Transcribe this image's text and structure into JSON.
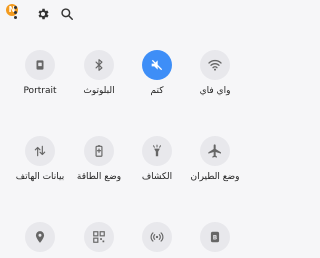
{
  "status": {
    "badge": "N",
    "icons": [
      "more-vert-icon",
      "gear-icon",
      "search-icon"
    ]
  },
  "tiles": [
    {
      "label": "Portrait",
      "icon": "screen-rotation-icon",
      "active": false
    },
    {
      "label": "البلوتوث",
      "icon": "bluetooth-icon",
      "active": false
    },
    {
      "label": "كتم",
      "icon": "mute-icon",
      "active": true
    },
    {
      "label": "واي فاي",
      "icon": "wifi-icon",
      "active": false
    },
    {
      "label": "بيانات الهاتف",
      "icon": "mobile-data-icon",
      "active": false
    },
    {
      "label": "وضع الطاقة",
      "icon": "battery-saver-icon",
      "active": false
    },
    {
      "label": "الكشاف",
      "icon": "flashlight-icon",
      "active": false
    },
    {
      "label": "وضع الطيران",
      "icon": "airplane-icon",
      "active": false
    },
    {
      "label": "",
      "icon": "location-icon",
      "active": false
    },
    {
      "label": "",
      "icon": "qr-code-icon",
      "active": false
    },
    {
      "label": "",
      "icon": "nearby-share-icon",
      "active": false
    },
    {
      "label": "",
      "icon": "bixby-icon",
      "active": false
    }
  ],
  "colors": {
    "accent": "#3e8ef7",
    "tile_bg": "#e8e8ec",
    "badge": "#f39b1f"
  }
}
